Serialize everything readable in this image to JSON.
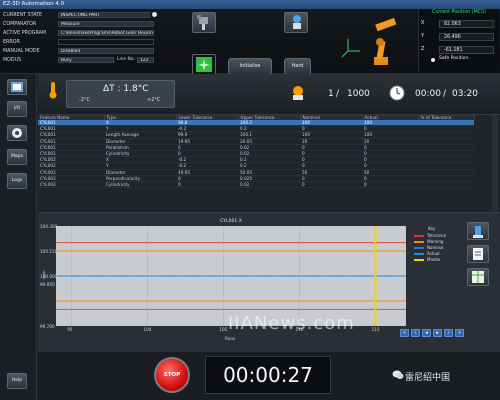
{
  "window": {
    "title": "EZ-3D Automation 4.0"
  },
  "top": {
    "fields": [
      {
        "label": "CURRENT STATE",
        "value": "INSPECTING PART"
      },
      {
        "label": "COMPARATOR",
        "value": "Measure"
      },
      {
        "label": "ACTIVE PROGRAM",
        "value": "C:\\Renishaw\\Programs\\Robot Gear Housing\\EM3"
      },
      {
        "label": "ERROR",
        "value": ""
      },
      {
        "label": "MANUAL MODE",
        "value": "Disabled"
      },
      {
        "label": "MODUS",
        "value": "Busy"
      }
    ],
    "line_no_label": "Line No:",
    "line_no_value": "122",
    "initialize_label": "Initialise",
    "hard_reset_label": "Hard Reset"
  },
  "position": {
    "title": "Current Position (MCS)",
    "rows": [
      {
        "axis": "X",
        "value": "82.063"
      },
      {
        "axis": "Y",
        "value": "26.496"
      },
      {
        "axis": "Z",
        "value": "-61.181"
      }
    ],
    "safe_label": "Safe Position"
  },
  "sidebar": {
    "items": [
      {
        "label": ""
      },
      {
        "label": "I/O"
      },
      {
        "label": ""
      },
      {
        "label": "Maps"
      },
      {
        "label": "Logs"
      },
      {
        "label": "Help"
      }
    ]
  },
  "cycle": {
    "delta_label": "ΔT : 1.8°C",
    "min_temp": "-2°C",
    "max_temp": "+2°C",
    "count_current": "1",
    "count_sep": "/",
    "count_total": "1000",
    "time_elapsed": "00:00",
    "time_sep": "/",
    "time_total": "03:20"
  },
  "table": {
    "headers": [
      "Feature Name",
      "Type",
      "Lower Tolerance",
      "Upper Tolerance",
      "Nominal",
      "Actual",
      "% of Tolerance"
    ],
    "rows": [
      [
        "CYL001",
        "X",
        "99.8",
        "100.2",
        "100",
        "100",
        ""
      ],
      [
        "CYL001",
        "Y",
        "-0.2",
        "0.2",
        "0",
        "0",
        ""
      ],
      [
        "CYL001",
        "Length Average",
        "99.9",
        "100.1",
        "100",
        "100",
        ""
      ],
      [
        "CYL001",
        "Diameter",
        "19.95",
        "20.05",
        "20",
        "20",
        ""
      ],
      [
        "CYL001",
        "Parallelism",
        "0",
        "0.02",
        "0",
        "0",
        ""
      ],
      [
        "CYL001",
        "Cylindricity",
        "0",
        "0.02",
        "0",
        "0",
        ""
      ],
      [
        "CYL002",
        "X",
        "-0.2",
        "0.2",
        "0",
        "0",
        ""
      ],
      [
        "CYL002",
        "Y",
        "-0.2",
        "0.2",
        "0",
        "0",
        ""
      ],
      [
        "CYL002",
        "Diameter",
        "49.95",
        "50.05",
        "50",
        "50",
        ""
      ],
      [
        "CYL002",
        "Perpendicularity",
        "0",
        "0.025",
        "0",
        "0",
        ""
      ],
      [
        "CYL002",
        "Cylindricity",
        "0",
        "0.02",
        "0",
        "0",
        ""
      ]
    ]
  },
  "chart_data": {
    "type": "line",
    "title": "CYL001 X",
    "xlabel": "Runs",
    "ylabel": "mm",
    "xlim": [
      94,
      117
    ],
    "ylim": [
      99.7,
      100.3
    ],
    "xticks": [
      95,
      100,
      105,
      110,
      115
    ],
    "yticks": [
      "100.300",
      "100.150",
      "100.000",
      "99.950",
      "99.700"
    ],
    "series": [
      {
        "name": "Tolerance",
        "color": "#e03131",
        "values_const": 100.2
      },
      {
        "name": "Tolerance",
        "color": "#e03131",
        "values_const": 99.8
      },
      {
        "name": "Warning",
        "color": "#f08c00",
        "values_const": 100.15
      },
      {
        "name": "Warning",
        "color": "#f08c00",
        "values_const": 99.85
      },
      {
        "name": "Nominal",
        "color": "#1c7ed6",
        "values_const": 100
      },
      {
        "name": "Actual",
        "color": "#228be6",
        "values_const": 100
      },
      {
        "name": "Master",
        "color": "#f2d300",
        "x_const": 115
      }
    ],
    "legend": {
      "title": "Key",
      "items": [
        "Tolerance",
        "Warning",
        "Nominal",
        "Actual",
        "Master"
      ],
      "position": "right"
    }
  },
  "bottom": {
    "stop_label": "STOP",
    "timer": "00:00:27",
    "watermark": "IIANews.com",
    "wechat": "雷尼绍中国"
  },
  "colors": {
    "accent": "#3b73b9",
    "stop": "#d10f0f",
    "position": "#32e06b"
  }
}
